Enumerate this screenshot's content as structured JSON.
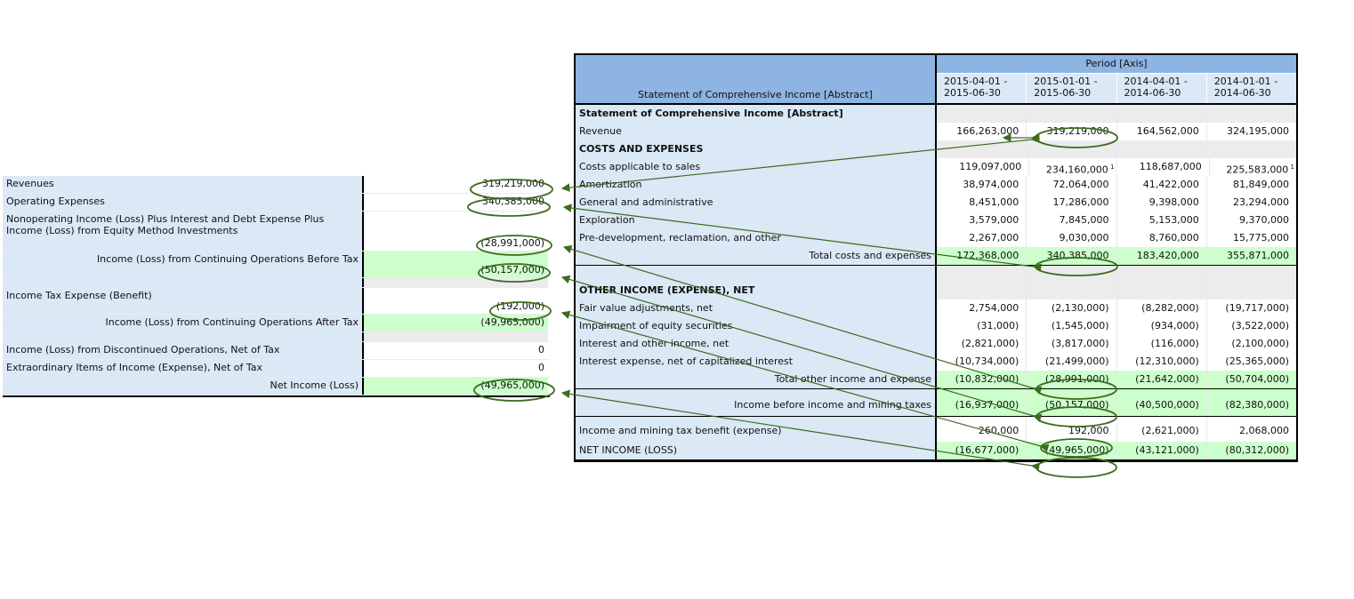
{
  "left_table": {
    "rows": [
      {
        "label": "Revenues",
        "value": "319,219,000",
        "kind": "normal"
      },
      {
        "label": "Operating Expenses",
        "value": "340,385,000",
        "kind": "normal"
      },
      {
        "label": "Nonoperating Income (Loss) Plus Interest and Debt Expense Plus Income (Loss) from Equity Method Investments",
        "value": "(28,991,000)",
        "kind": "tall"
      },
      {
        "label": "Income (Loss) from Continuing Operations Before Tax",
        "value": "(50,157,000)",
        "kind": "total"
      },
      {
        "label": "",
        "value": "",
        "kind": "spacer"
      },
      {
        "label": "Income Tax Expense (Benefit)",
        "value": "(192,000)",
        "kind": "tall2"
      },
      {
        "label": "Income (Loss) from Continuing Operations After Tax",
        "value": "(49,965,000)",
        "kind": "total"
      },
      {
        "label": "",
        "value": "",
        "kind": "spacer"
      },
      {
        "label": "Income (Loss) from Discontinued Operations, Net of Tax",
        "value": "0",
        "kind": "normal"
      },
      {
        "label": "Extraordinary Items of Income (Expense), Net of Tax",
        "value": "0",
        "kind": "normal"
      },
      {
        "label": "Net Income (Loss)",
        "value": "(49,965,000)",
        "kind": "total"
      }
    ]
  },
  "right_table": {
    "title": "Statement of Comprehensive Income [Abstract]",
    "axis": "Period [Axis]",
    "periods": [
      {
        "line1": "2015-04-01 -",
        "line2": "2015-06-30"
      },
      {
        "line1": "2015-01-01 -",
        "line2": "2015-06-30"
      },
      {
        "line1": "2014-04-01 -",
        "line2": "2014-06-30"
      },
      {
        "line1": "2014-01-01 -",
        "line2": "2014-06-30"
      }
    ],
    "footnote_mark": "1",
    "rows": [
      {
        "label": "Statement of Comprehensive Income [Abstract]",
        "kind": "sec",
        "values": [
          "",
          "",
          "",
          ""
        ]
      },
      {
        "label": "Revenue",
        "kind": "normal",
        "values": [
          "166,263,000",
          "319,219,000",
          "164,562,000",
          "324,195,000"
        ]
      },
      {
        "label": "COSTS AND EXPENSES",
        "kind": "sec",
        "values": [
          "",
          "",
          "",
          ""
        ]
      },
      {
        "label": "Costs applicable to sales",
        "kind": "normal",
        "values": [
          "119,097,000",
          "234,160,000",
          "118,687,000",
          "225,583,000"
        ],
        "foot": [
          false,
          true,
          false,
          true
        ]
      },
      {
        "label": "Amortization",
        "kind": "normal",
        "values": [
          "38,974,000",
          "72,064,000",
          "41,422,000",
          "81,849,000"
        ]
      },
      {
        "label": "General and administrative",
        "kind": "normal",
        "values": [
          "8,451,000",
          "17,286,000",
          "9,398,000",
          "23,294,000"
        ]
      },
      {
        "label": "Exploration",
        "kind": "normal",
        "values": [
          "3,579,000",
          "7,845,000",
          "5,153,000",
          "9,370,000"
        ]
      },
      {
        "label": "Pre-development, reclamation, and other",
        "kind": "normal",
        "values": [
          "2,267,000",
          "9,030,000",
          "8,760,000",
          "15,775,000"
        ]
      },
      {
        "label": "Total costs and expenses",
        "kind": "total",
        "values": [
          "172,368,000",
          "340,385,000",
          "183,420,000",
          "355,871,000"
        ]
      },
      {
        "label": "OTHER INCOME (EXPENSE), NET",
        "kind": "sec-tall",
        "values": [
          "",
          "",
          "",
          ""
        ]
      },
      {
        "label": "Fair value adjustments, net",
        "kind": "normal",
        "values": [
          "2,754,000",
          "(2,130,000)",
          "(8,282,000)",
          "(19,717,000)"
        ]
      },
      {
        "label": "Impairment of equity securities",
        "kind": "normal",
        "values": [
          "(31,000)",
          "(1,545,000)",
          "(934,000)",
          "(3,522,000)"
        ]
      },
      {
        "label": "Interest and other income, net",
        "kind": "normal",
        "values": [
          "(2,821,000)",
          "(3,817,000)",
          "(116,000)",
          "(2,100,000)"
        ]
      },
      {
        "label": "Interest expense, net of capitalized interest",
        "kind": "normal",
        "values": [
          "(10,734,000)",
          "(21,499,000)",
          "(12,310,000)",
          "(25,365,000)"
        ]
      },
      {
        "label": "Total other income and expense",
        "kind": "total",
        "values": [
          "(10,832,000)",
          "(28,991,000)",
          "(21,642,000)",
          "(50,704,000)"
        ]
      },
      {
        "label": "Income before income and mining taxes",
        "kind": "total-tall",
        "values": [
          "(16,937,000)",
          "(50,157,000)",
          "(40,500,000)",
          "(82,380,000)"
        ]
      },
      {
        "label": "Income and mining tax benefit (expense)",
        "kind": "normal-tall",
        "values": [
          "260,000",
          "192,000",
          "(2,621,000)",
          "2,068,000"
        ]
      },
      {
        "label": "NET INCOME (LOSS)",
        "kind": "total-last",
        "values": [
          "(16,677,000)",
          "(49,965,000)",
          "(43,121,000)",
          "(80,312,000)"
        ]
      }
    ]
  },
  "colors": {
    "header_blue": "#8db4e2",
    "label_blue": "#dbe8f6",
    "total_green": "#ccffcc",
    "annotation_green": "#3d6b1f"
  }
}
